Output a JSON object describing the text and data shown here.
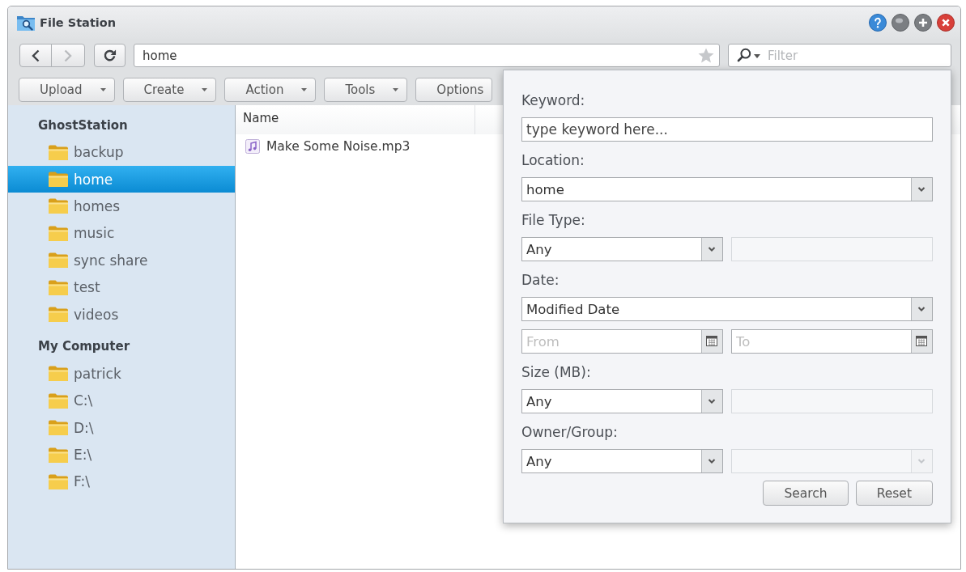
{
  "window": {
    "title": "File Station"
  },
  "nav_buttons": [
    {
      "kind": "back",
      "disabled": false
    },
    {
      "kind": "forward",
      "disabled": true
    },
    {
      "kind": "refresh",
      "disabled": false
    }
  ],
  "address": {
    "path": "home",
    "favorite": false
  },
  "filter": {
    "placeholder": "Filter"
  },
  "toolbar": [
    {
      "label": "Upload",
      "caret": true
    },
    {
      "label": "Create",
      "caret": true
    },
    {
      "label": "Action",
      "caret": true
    },
    {
      "label": "Tools",
      "caret": true
    },
    {
      "label": "Options",
      "caret": false
    }
  ],
  "sidebar": {
    "groups": [
      {
        "title": "GhostStation",
        "items": [
          {
            "label": "backup",
            "selected": false
          },
          {
            "label": "home",
            "selected": true
          },
          {
            "label": "homes",
            "selected": false
          },
          {
            "label": "music",
            "selected": false
          },
          {
            "label": "sync share",
            "selected": false
          },
          {
            "label": "test",
            "selected": false
          },
          {
            "label": "videos",
            "selected": false
          }
        ]
      },
      {
        "title": "My Computer",
        "items": [
          {
            "label": "patrick",
            "selected": false
          },
          {
            "label": "C:\\",
            "selected": false
          },
          {
            "label": "D:\\",
            "selected": false
          },
          {
            "label": "E:\\",
            "selected": false
          },
          {
            "label": "F:\\",
            "selected": false
          }
        ]
      }
    ]
  },
  "file_list": {
    "columns": [
      "Name"
    ],
    "rows": [
      {
        "name": "Make Some Noise.mp3",
        "kind": "audio"
      }
    ]
  },
  "search_panel": {
    "rows": [
      {
        "label": "Keyword:",
        "controls": [
          {
            "kind": "text",
            "placeholder": "type keyword here...",
            "disabled": false
          }
        ]
      },
      {
        "label": "Location:",
        "controls": [
          {
            "kind": "select",
            "value": "home",
            "disabled": false
          }
        ]
      },
      {
        "label": "File Type:",
        "controls": [
          {
            "kind": "select",
            "value": "Any",
            "disabled": false
          },
          {
            "kind": "text",
            "disabled": true
          }
        ]
      },
      {
        "label": "Date:",
        "controls": [
          {
            "kind": "select",
            "value": "Modified Date",
            "disabled": false
          }
        ]
      },
      {
        "controls": [
          {
            "kind": "date",
            "placeholder": "From",
            "disabled": false
          },
          {
            "kind": "date",
            "placeholder": "To",
            "disabled": false
          }
        ]
      },
      {
        "label": "Size (MB):",
        "controls": [
          {
            "kind": "select",
            "value": "Any",
            "disabled": false
          },
          {
            "kind": "text",
            "disabled": true
          }
        ]
      },
      {
        "label": "Owner/Group:",
        "controls": [
          {
            "kind": "select",
            "value": "Any",
            "disabled": false
          },
          {
            "kind": "select",
            "disabled": true
          }
        ]
      }
    ],
    "buttons": [
      "Search",
      "Reset"
    ]
  }
}
